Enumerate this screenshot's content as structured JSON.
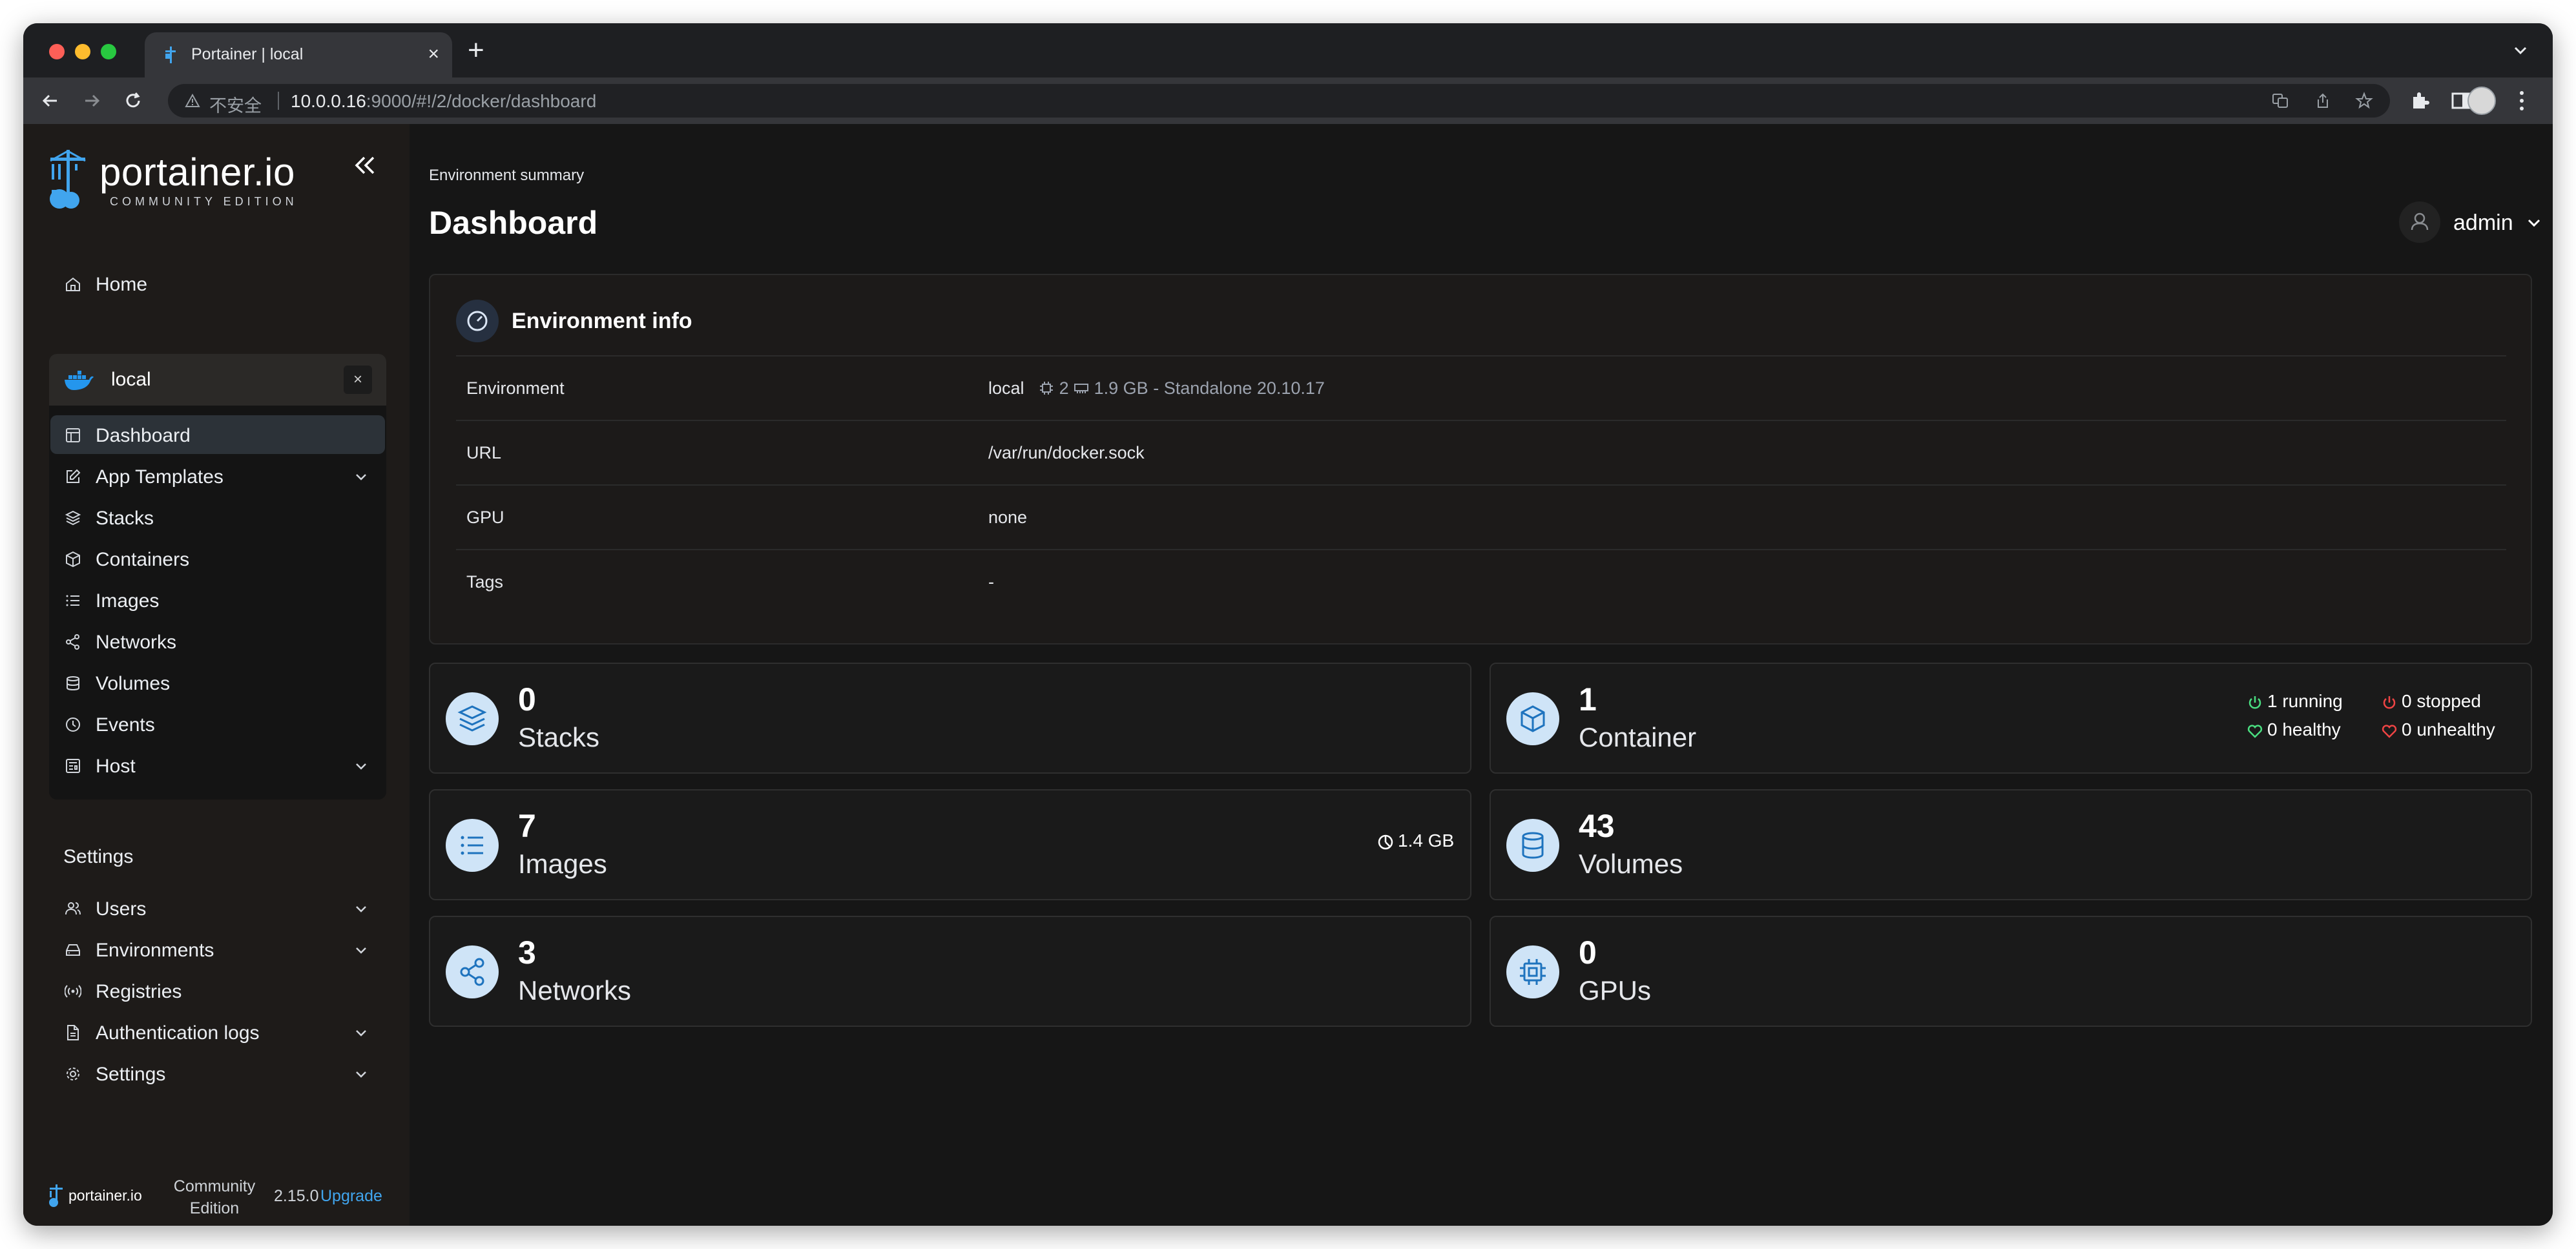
{
  "browser": {
    "tab_title": "Portainer | local",
    "new_tab": "+",
    "tab_close": "×",
    "insecure_label": "不安全",
    "url_host": "10.0.0.16",
    "url_rest": ":9000/#!/2/docker/dashboard"
  },
  "sidebar": {
    "logo_text": "portainer.io",
    "logo_sub": "COMMUNITY EDITION",
    "home": "Home",
    "environment": {
      "name": "local",
      "close": "×",
      "items": [
        {
          "label": "Dashboard",
          "icon": "dashboard-icon"
        },
        {
          "label": "App Templates",
          "icon": "edit-icon"
        },
        {
          "label": "Stacks",
          "icon": "layers-icon"
        },
        {
          "label": "Containers",
          "icon": "box-icon"
        },
        {
          "label": "Images",
          "icon": "list-icon"
        },
        {
          "label": "Networks",
          "icon": "share-icon"
        },
        {
          "label": "Volumes",
          "icon": "database-icon"
        },
        {
          "label": "Events",
          "icon": "clock-icon"
        },
        {
          "label": "Host",
          "icon": "host-icon"
        }
      ]
    },
    "settings_heading": "Settings",
    "settings_items": [
      {
        "label": "Users",
        "icon": "users-icon"
      },
      {
        "label": "Environments",
        "icon": "hdd-icon"
      },
      {
        "label": "Registries",
        "icon": "radio-icon"
      },
      {
        "label": "Authentication logs",
        "icon": "file-icon"
      },
      {
        "label": "Settings",
        "icon": "gear-icon"
      }
    ],
    "footer": {
      "logo_text": "portainer.io",
      "edition_line1": "Community",
      "edition_line2": "Edition",
      "version": "2.15.0",
      "upgrade": "Upgrade"
    }
  },
  "header": {
    "breadcrumb": "Environment summary",
    "title": "Dashboard",
    "user": "admin"
  },
  "environment_info": {
    "title": "Environment info",
    "rows": [
      {
        "key": "Environment",
        "value": "local",
        "cpu": "2",
        "memory": "1.9 GB",
        "mode": "- Standalone 20.10.17"
      },
      {
        "key": "URL",
        "value": "/var/run/docker.sock"
      },
      {
        "key": "GPU",
        "value": "none"
      },
      {
        "key": "Tags",
        "value": "-"
      }
    ]
  },
  "stats": {
    "stacks": {
      "count": "0",
      "label": "Stacks"
    },
    "containers": {
      "count": "1",
      "label": "Container",
      "running": "1 running",
      "stopped": "0 stopped",
      "healthy": "0 healthy",
      "unhealthy": "0 unhealthy"
    },
    "images": {
      "count": "7",
      "label": "Images",
      "size": "1.4 GB"
    },
    "volumes": {
      "count": "43",
      "label": "Volumes"
    },
    "networks": {
      "count": "3",
      "label": "Networks"
    },
    "gpus": {
      "count": "0",
      "label": "GPUs"
    }
  },
  "colors": {
    "accent": "#41a5ee",
    "running": "#4ade80",
    "stopped": "#ef4444",
    "icon_circle": "#cfe4f7",
    "icon_fg": "#1e73be"
  }
}
